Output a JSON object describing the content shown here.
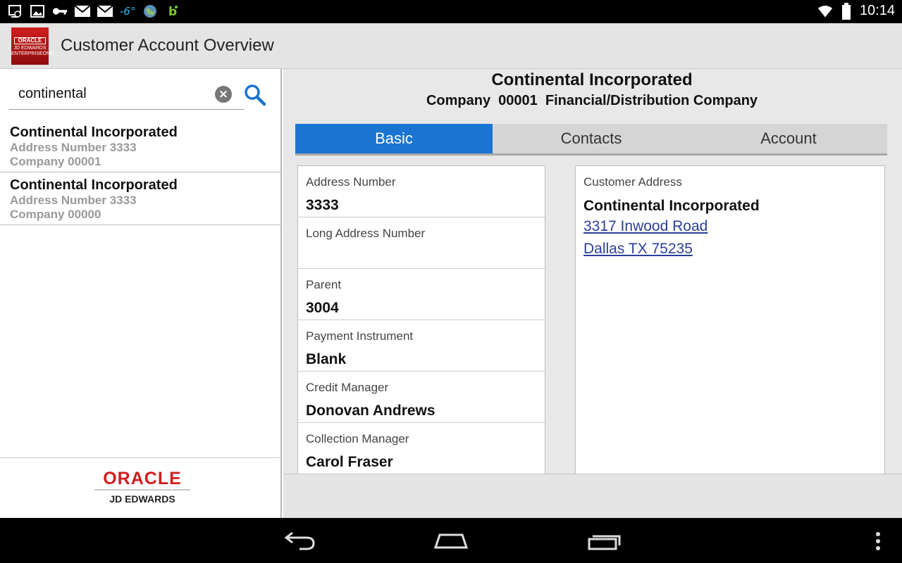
{
  "status_bar": {
    "temperature": "-6°",
    "time": "10:14",
    "icons": [
      "screenshot-icon",
      "image-icon",
      "key-icon",
      "mail-icon",
      "mail-icon",
      "globe-icon",
      "app-b-icon",
      "wifi-icon",
      "battery-icon"
    ],
    "accent_color": "#33b5e5"
  },
  "action_bar": {
    "title": "Customer Account Overview",
    "logo_text_line1": "ORACLE",
    "logo_text_line2": "JD EDWARDS",
    "logo_text_line3": "ENTERPRISEONE"
  },
  "search": {
    "value": "continental",
    "placeholder": ""
  },
  "results": [
    {
      "name": "Continental Incorporated",
      "address_number": "Address Number 3333",
      "company": "Company 00001"
    },
    {
      "name": "Continental Incorporated",
      "address_number": "Address Number 3333",
      "company": "Company 00000"
    }
  ],
  "branding": {
    "oracle": "ORACLE",
    "jde": "JD EDWARDS",
    "brand_color": "#d21c1c"
  },
  "detail": {
    "name": "Continental Incorporated",
    "company_line": "Company  00001  Financial/Distribution Company",
    "tabs": [
      {
        "label": "Basic",
        "active": true
      },
      {
        "label": "Contacts",
        "active": false
      },
      {
        "label": "Account",
        "active": false
      }
    ],
    "active_tab_color": "#1a74d1",
    "fields": [
      {
        "label": "Address Number",
        "value": "3333"
      },
      {
        "label": "Long Address Number",
        "value": ""
      },
      {
        "label": "Parent",
        "value": "3004"
      },
      {
        "label": "Payment Instrument",
        "value": "Blank"
      },
      {
        "label": "Credit Manager",
        "value": "Donovan Andrews"
      },
      {
        "label": "Collection Manager",
        "value": "Carol Fraser"
      }
    ],
    "address": {
      "label": "Customer Address",
      "name": "Continental Incorporated",
      "line1": "3317 Inwood Road",
      "line2": "Dallas TX 75235",
      "link_color": "#2a3e9a"
    }
  },
  "nav_bar": {
    "icons": [
      "back-icon",
      "home-icon",
      "recent-apps-icon",
      "overflow-menu-icon"
    ]
  }
}
